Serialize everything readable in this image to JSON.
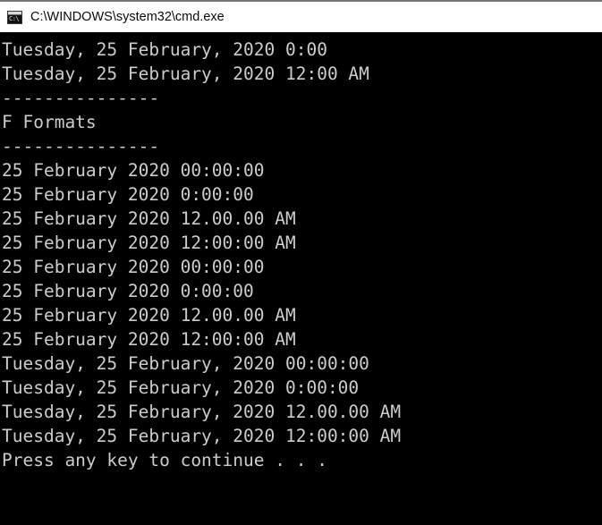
{
  "window": {
    "title": "C:\\WINDOWS\\system32\\cmd.exe",
    "icon": "cmd-console-icon",
    "icon_text": "C:\\",
    "titlebar_bg": "#ffffff",
    "titlebar_text_color": "#0a0a0a",
    "console_bg": "#000000",
    "console_text_color": "#cccccc"
  },
  "console": {
    "lines": [
      "Tuesday, 25 February, 2020 0:00",
      "Tuesday, 25 February, 2020 12:00 AM",
      "---------------",
      "F Formats",
      "---------------",
      "25 February 2020 00:00:00",
      "25 February 2020 0:00:00",
      "25 February 2020 12.00.00 AM",
      "25 February 2020 12:00:00 AM",
      "25 February 2020 00:00:00",
      "25 February 2020 0:00:00",
      "25 February 2020 12.00.00 AM",
      "25 February 2020 12:00:00 AM",
      "Tuesday, 25 February, 2020 00:00:00",
      "Tuesday, 25 February, 2020 0:00:00",
      "Tuesday, 25 February, 2020 12.00.00 AM",
      "Tuesday, 25 February, 2020 12:00:00 AM",
      "Press any key to continue . . ."
    ]
  }
}
